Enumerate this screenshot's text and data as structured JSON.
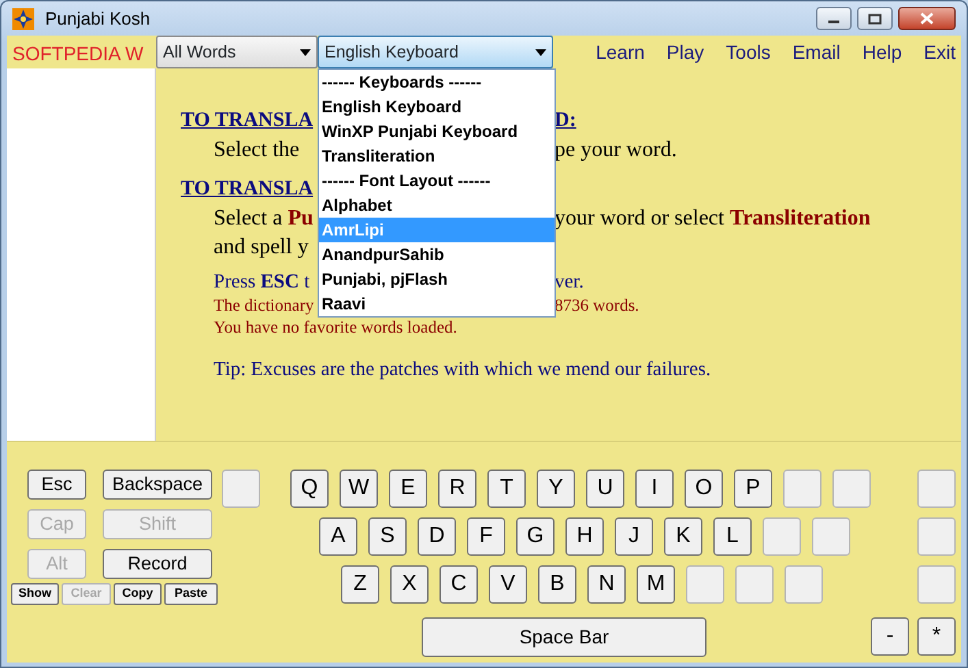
{
  "window": {
    "title": "Punjabi Kosh"
  },
  "toolbar": {
    "word_field": {
      "value": "SOFTPEDIA W"
    },
    "dropdowns": [
      {
        "value": "All Words",
        "focused": false
      },
      {
        "value": "English Keyboard",
        "focused": true
      }
    ],
    "menu": [
      "Learn",
      "Play",
      "Tools",
      "Email",
      "Help",
      "Exit"
    ]
  },
  "dropdown_list": [
    {
      "label": "------ Keyboards ------",
      "selected": false
    },
    {
      "label": "English Keyboard",
      "selected": false
    },
    {
      "label": "WinXP Punjabi Keyboard",
      "selected": false
    },
    {
      "label": "Transliteration",
      "selected": false
    },
    {
      "label": "------ Font Layout ------",
      "selected": false
    },
    {
      "label": "Alphabet",
      "selected": false
    },
    {
      "label": "AmrLipi",
      "selected": true
    },
    {
      "label": "AnandpurSahib",
      "selected": false
    },
    {
      "label": "Punjabi, pjFlash",
      "selected": false
    },
    {
      "label": "Raavi",
      "selected": false
    }
  ],
  "instructions": [
    {
      "kind": "heading",
      "left": "TO TRANSLA",
      "right": "D:"
    },
    {
      "kind": "body",
      "left": "Select the",
      "right": "pe your word."
    },
    {
      "kind": "heading",
      "left": "TO TRANSLA"
    },
    {
      "kind": "body",
      "left": "Select a **Pu**",
      "right": "your word or select **Transliteration**"
    },
    {
      "kind": "body",
      "left": "and spell y"
    },
    {
      "kind": "small",
      "left": "Press **ESC** t",
      "right": "ver."
    },
    {
      "kind": "note",
      "left": "The dictionary",
      "right": "8736 words."
    },
    {
      "kind": "note",
      "text": "You have no favorite words loaded."
    },
    {
      "kind": "tip",
      "text": "Tip: Excuses are the patches with which we mend our failures."
    }
  ],
  "keyboard": {
    "side_rows": [
      [
        {
          "label": "Esc",
          "disabled": false,
          "kind": "short"
        },
        {
          "label": "Backspace",
          "disabled": false,
          "kind": "wide"
        }
      ],
      [
        {
          "label": "Cap",
          "disabled": true,
          "kind": "short"
        },
        {
          "label": "Shift",
          "disabled": true,
          "kind": "wide"
        }
      ],
      [
        {
          "label": "Alt",
          "disabled": true,
          "kind": "short"
        },
        {
          "label": "Record",
          "disabled": false,
          "kind": "wide"
        }
      ]
    ],
    "small_buttons": [
      {
        "label": "Show",
        "disabled": false
      },
      {
        "label": "Clear",
        "disabled": true
      },
      {
        "label": "Copy",
        "disabled": false
      },
      {
        "label": "Paste",
        "disabled": false
      }
    ],
    "rows": [
      [
        {
          "disabled": true
        },
        {
          "label": "Q",
          "disabled": false
        },
        {
          "label": "W",
          "disabled": false
        },
        {
          "label": "E",
          "disabled": false
        },
        {
          "label": "R",
          "disabled": false
        },
        {
          "label": "T",
          "disabled": false
        },
        {
          "label": "Y",
          "disabled": false
        },
        {
          "label": "U",
          "disabled": false
        },
        {
          "label": "I",
          "disabled": false
        },
        {
          "label": "O",
          "disabled": false
        },
        {
          "label": "P",
          "disabled": false
        },
        {
          "disabled": true
        },
        {
          "disabled": true
        },
        {
          "disabled": true
        }
      ],
      [
        {
          "label": "A",
          "disabled": false
        },
        {
          "label": "S",
          "disabled": false
        },
        {
          "label": "D",
          "disabled": false
        },
        {
          "label": "F",
          "disabled": false
        },
        {
          "label": "G",
          "disabled": false
        },
        {
          "label": "H",
          "disabled": false
        },
        {
          "label": "J",
          "disabled": false
        },
        {
          "label": "K",
          "disabled": false
        },
        {
          "label": "L",
          "disabled": false
        },
        {
          "disabled": true
        },
        {
          "disabled": true
        },
        {
          "disabled": true
        }
      ],
      [
        {
          "label": "Z",
          "disabled": false
        },
        {
          "label": "X",
          "disabled": false
        },
        {
          "label": "C",
          "disabled": false
        },
        {
          "label": "V",
          "disabled": false
        },
        {
          "label": "B",
          "disabled": false
        },
        {
          "label": "N",
          "disabled": false
        },
        {
          "label": "M",
          "disabled": false
        },
        {
          "disabled": true
        },
        {
          "disabled": true
        },
        {
          "disabled": true
        },
        {
          "disabled": true
        }
      ]
    ],
    "space_bar": "Space Bar",
    "extra_keys": [
      "-",
      "*"
    ]
  }
}
